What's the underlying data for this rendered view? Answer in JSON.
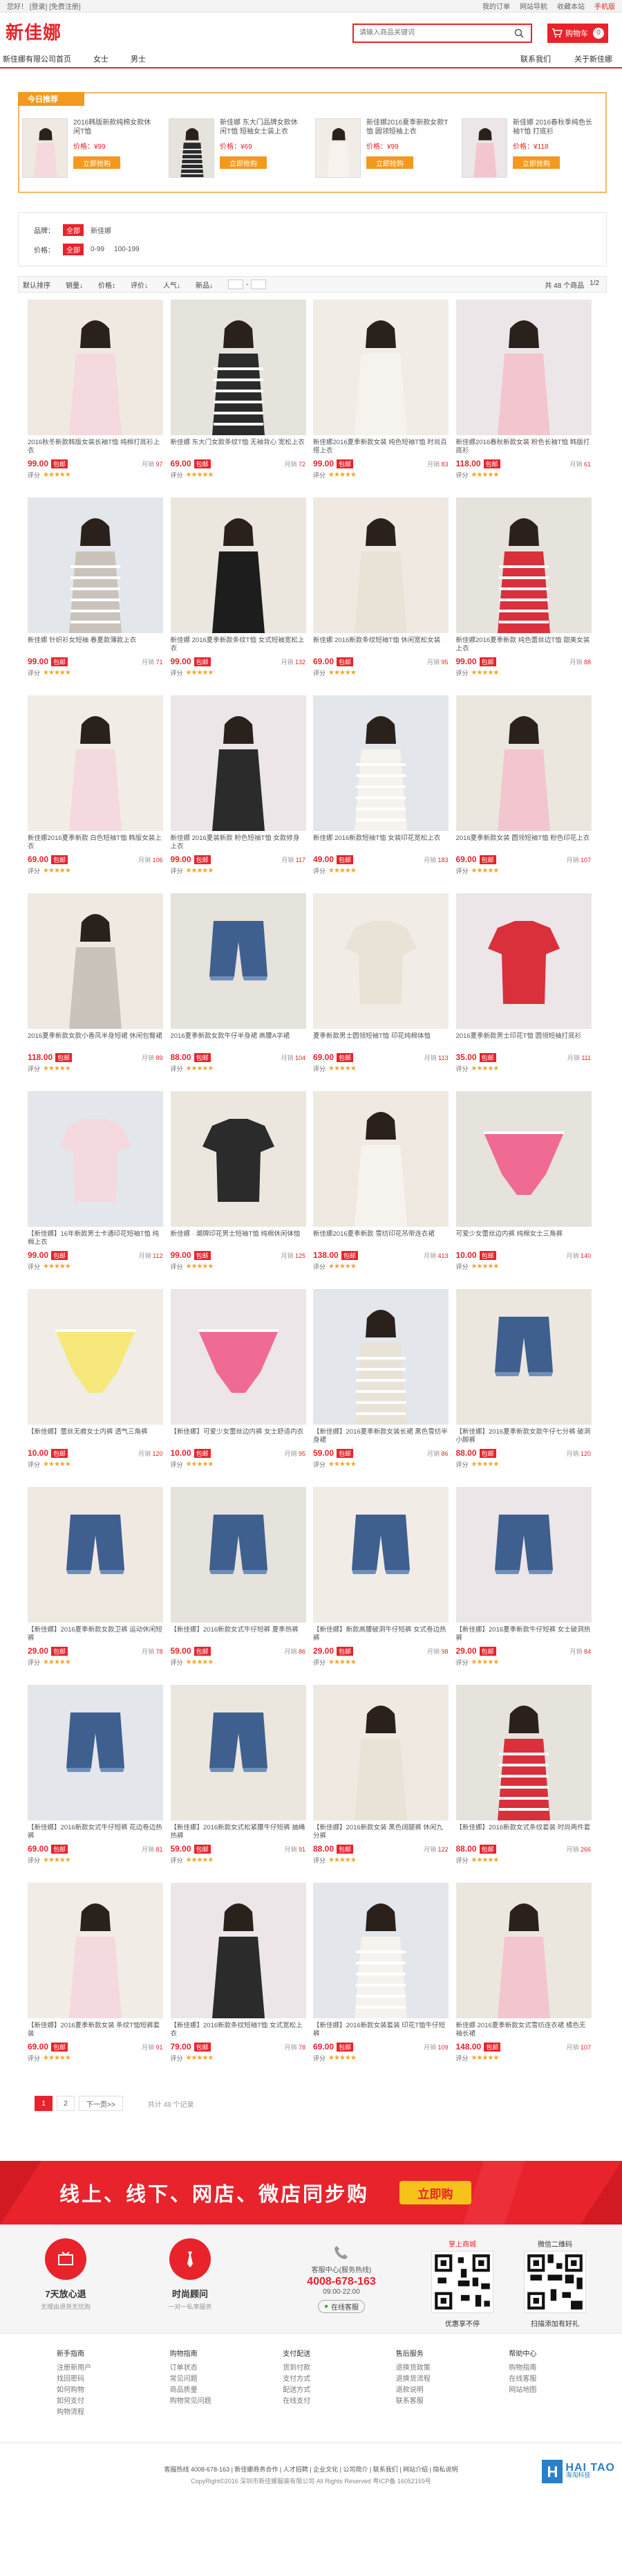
{
  "topbar": {
    "left": "您好！ [登录] [免费注册]",
    "right": [
      "我的订单",
      "网站导航",
      "收藏本站",
      "手机版"
    ]
  },
  "logo": "新佳娜",
  "search": {
    "placeholder": "请输入商品关键词"
  },
  "cart": {
    "label": "购物车",
    "count": "0"
  },
  "nav": {
    "left": [
      "新佳娜有限公司首页",
      "女士",
      "男士"
    ],
    "right": [
      "联系我们",
      "关于新佳娜"
    ]
  },
  "today": {
    "tag": "今日推荐",
    "items": [
      {
        "name": "2016韩版新款纯棉女款休闲T恤",
        "price": "价格：¥99",
        "buy": "立即抢购"
      },
      {
        "name": "新佳娜 东大门品牌女款休闲T恤 短袖女士装上衣",
        "price": "价格：¥69",
        "buy": "立即抢购"
      },
      {
        "name": "新佳娜2016夏季新款女款T恤 圆领短袖上衣",
        "price": "价格：¥99",
        "buy": "立即抢购"
      },
      {
        "name": "新佳娜 2016春秋季纯色长袖T恤 打底衫",
        "price": "价格：¥118",
        "buy": "立即抢购"
      }
    ]
  },
  "filter": {
    "brand_label": "品牌：",
    "brand_all": "全部",
    "brand_opt": "新佳娜",
    "price_label": "价格：",
    "price_all": "全部",
    "price_opts": [
      "0-99",
      "100-199"
    ]
  },
  "sortbar": {
    "items": [
      "默认排序",
      "销量↓",
      "价格↕",
      "评价↓",
      "人气↓",
      "新品↓"
    ],
    "range_sep": "-",
    "total": "共 48 个商品",
    "page": "1/2"
  },
  "products": [
    {
      "desc": "2016秋冬新款韩版女装长袖T恤 纯棉打底衫上衣",
      "price": "99.00",
      "sold": "97",
      "rating": "评分"
    },
    {
      "desc": "新佳娜 东大门女款条纹T恤 无袖背心 宽松上衣",
      "price": "69.00",
      "sold": "72",
      "rating": "评分"
    },
    {
      "desc": "新佳娜2016夏季新款女装 纯色短袖T恤 时尚百搭上衣",
      "price": "99.00",
      "sold": "83",
      "rating": "评分"
    },
    {
      "desc": "新佳娜2016春秋新款女装 粉色长袖T恤 韩版打底衫",
      "price": "118.00",
      "sold": "61",
      "rating": "评分"
    },
    {
      "desc": "新佳娜 针织衫女短袖 春夏款薄款上衣",
      "price": "99.00",
      "sold": "71",
      "rating": "评分"
    },
    {
      "desc": "新佳娜 2016夏季新款条纹T恤 女式短袖宽松上衣",
      "price": "99.00",
      "sold": "132",
      "rating": "评分"
    },
    {
      "desc": "新佳娜 2016新款条纹短袖T恤 休闲宽松女装",
      "price": "69.00",
      "sold": "95",
      "rating": "评分"
    },
    {
      "desc": "新佳娜2016夏季新款 纯色蕾丝边T恤 甜美女装上衣",
      "price": "99.00",
      "sold": "88",
      "rating": "评分"
    },
    {
      "desc": "新佳娜2016夏季新款 白色短袖T恤 韩版女装上衣",
      "price": "69.00",
      "sold": "106",
      "rating": "评分"
    },
    {
      "desc": "新佳娜 2016夏装新款 粉色短袖T恤 女款修身上衣",
      "price": "99.00",
      "sold": "117",
      "rating": "评分"
    },
    {
      "desc": "新佳娜 2016新款短袖T恤 女装印花宽松上衣",
      "price": "49.00",
      "sold": "183",
      "rating": "评分"
    },
    {
      "desc": "2016夏季新款女装 圆领短袖T恤 粉色印花上衣",
      "price": "69.00",
      "sold": "107",
      "rating": "评分"
    },
    {
      "desc": "2016夏季新款女款小香风半身短裙 休闲包臀裙",
      "price": "118.00",
      "sold": "89",
      "rating": "评分"
    },
    {
      "desc": "2016夏季新款女款牛仔半身裙 高腰A字裙",
      "price": "88.00",
      "sold": "104",
      "rating": "评分"
    },
    {
      "desc": "夏季新款男士圆领短袖T恤 印花纯棉体恤",
      "price": "69.00",
      "sold": "113",
      "rating": "评分"
    },
    {
      "desc": "2016夏季新款男士印花T恤 圆领短袖打底衫",
      "price": "35.00",
      "sold": "111",
      "rating": "评分"
    },
    {
      "desc": "【新佳娜】16年新款男士卡通印花短袖T恤 纯棉上衣",
      "price": "99.00",
      "sold": "112",
      "rating": "评分"
    },
    {
      "desc": "新佳娜 · 潮牌印花男士短袖T恤 纯棉休闲体恤",
      "price": "99.00",
      "sold": "125",
      "rating": "评分"
    },
    {
      "desc": "新佳娜2016夏季新款 雪纺印花吊带连衣裙",
      "price": "138.00",
      "sold": "413",
      "rating": "评分"
    },
    {
      "desc": "可爱少女蕾丝边内裤 纯棉女士三角裤",
      "price": "10.00",
      "sold": "140",
      "rating": "评分"
    },
    {
      "desc": "【新佳娜】蕾丝无痕女士内裤 透气三角裤",
      "price": "10.00",
      "sold": "120",
      "rating": "评分"
    },
    {
      "desc": "【新佳娜】可爱少女蕾丝边内裤 女士舒适内衣",
      "price": "10.00",
      "sold": "95",
      "rating": "评分"
    },
    {
      "desc": "【新佳娜】2016夏季新款女装长裙 黑色雪纺半身裙",
      "price": "59.00",
      "sold": "86",
      "rating": "评分"
    },
    {
      "desc": "【新佳娜】2016夏季新款女款牛仔七分裤 破洞小脚裤",
      "price": "88.00",
      "sold": "120",
      "rating": "评分"
    },
    {
      "desc": "【新佳娜】2016夏季新款女款卫裤 运动休闲短裤",
      "price": "29.00",
      "sold": "78",
      "rating": "评分"
    },
    {
      "desc": "【新佳娜】2016新款女式牛仔短裤 夏季热裤",
      "price": "59.00",
      "sold": "86",
      "rating": "评分"
    },
    {
      "desc": "【新佳娜】新款高腰破洞牛仔短裤 女式卷边热裤",
      "price": "29.00",
      "sold": "98",
      "rating": "评分"
    },
    {
      "desc": "【新佳娜】2016夏季新款牛仔短裤 女士破洞热裤",
      "price": "29.00",
      "sold": "84",
      "rating": "评分"
    },
    {
      "desc": "【新佳娜】2016新款女式牛仔短裤 花边卷边热裤",
      "price": "69.00",
      "sold": "81",
      "rating": "评分"
    },
    {
      "desc": "【新佳娜】2016新款女式松紧腰牛仔短裤 抽绳热裤",
      "price": "59.00",
      "sold": "91",
      "rating": "评分"
    },
    {
      "desc": "【新佳娜】2016新款女装 黑色阔腿裤 休闲九分裤",
      "price": "88.00",
      "sold": "122",
      "rating": "评分"
    },
    {
      "desc": "【新佳娜】2016新款女式条纹套装 时尚两件套",
      "price": "88.00",
      "sold": "266",
      "rating": "评分"
    },
    {
      "desc": "【新佳娜】2016夏季新款女装 条纹T恤短裤套装",
      "price": "69.00",
      "sold": "91",
      "rating": "评分"
    },
    {
      "desc": "【新佳娜】2016新款条纹短袖T恤 女式宽松上衣",
      "price": "79.00",
      "sold": "78",
      "rating": "评分"
    },
    {
      "desc": "【新佳娜】2016新款女装套装 印花T恤牛仔短裤",
      "price": "69.00",
      "sold": "109",
      "rating": "评分"
    },
    {
      "desc": "新佳娜 2016夏季新款女式雪纺连衣裙 橘色无袖长裙",
      "price": "148.00",
      "sold": "107",
      "rating": "评分"
    }
  ],
  "badge": "包邮",
  "sold_label": "月销",
  "pager": {
    "pages": [
      "1",
      "2"
    ],
    "next": "下一页>>",
    "total": "共计 48 个记录"
  },
  "banner": {
    "slogan": "线上、线下、网店、微店同步购",
    "btn": "立即购"
  },
  "services": [
    {
      "title": "7天放心退",
      "sub": "无理由退货无忧购"
    },
    {
      "title": "时尚顾问",
      "sub": "一对一私享服务"
    }
  ],
  "hotline": {
    "label": "客服中心(服务热线)",
    "number": "4008-678-163",
    "hours": "09:00-22:00",
    "online": "在线客服"
  },
  "qrcodes": [
    {
      "title": "掌上商城",
      "caption": "优惠享不停"
    },
    {
      "title": "微信二维码",
      "caption": "扫描添加有好礼"
    }
  ],
  "links": [
    {
      "head": "新手指南",
      "items": [
        "注册新用户",
        "找回密码",
        "如何购物",
        "如何支付",
        "购物流程"
      ]
    },
    {
      "head": "购物指南",
      "items": [
        "订单状态",
        "常见问题",
        "商品质量",
        "购物常见问题"
      ]
    },
    {
      "head": "支付配送",
      "items": [
        "货到付款",
        "支付方式",
        "配送方式",
        "在线支付"
      ]
    },
    {
      "head": "售后服务",
      "items": [
        "退换货政策",
        "退换货流程",
        "退款说明",
        "联系客服"
      ]
    },
    {
      "head": "帮助中心",
      "items": [
        "购物指南",
        "在线客服",
        "网站地图"
      ]
    }
  ],
  "footer": {
    "line1": "客服热线 4008-678-163 | 新佳娜商务合作 | 人才招聘 | 企业文化 | 公司简介 | 联系我们 | 网站介绍 | 隐私说明",
    "line2": "CopyRight©2016 深圳市新佳娜服装有限公司 All Rights Reserved 粤ICP备 16052159号"
  },
  "watermark": {
    "brand": "HAI TAO",
    "cn": "海淘科技"
  },
  "colors": {
    "accent": "#e8232c",
    "orange": "#f39a1e",
    "star": "#f5a623"
  }
}
